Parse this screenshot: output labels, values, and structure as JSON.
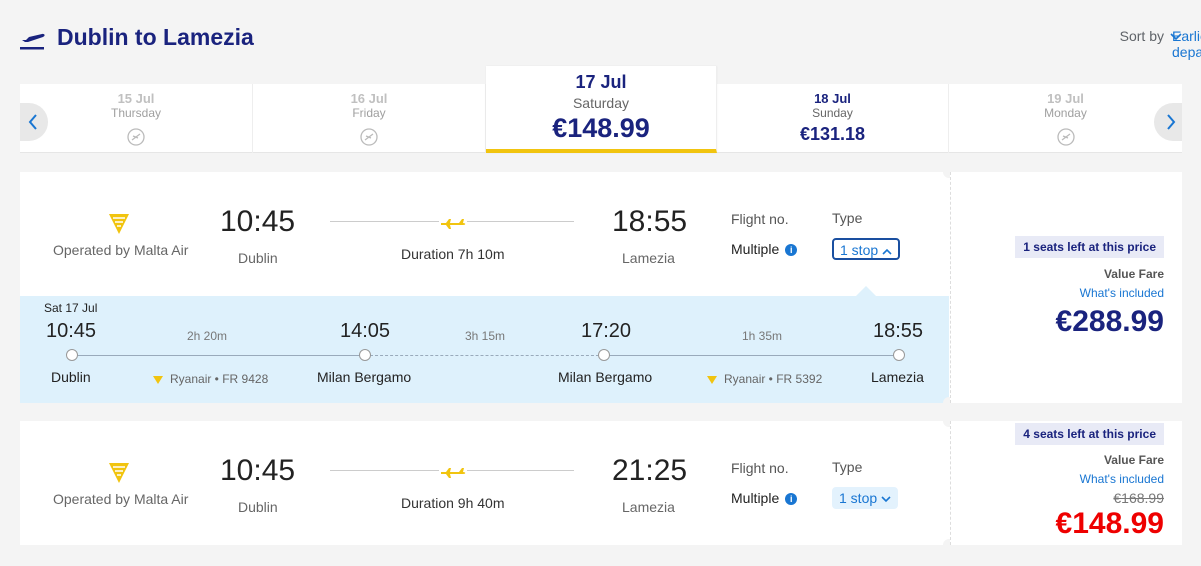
{
  "header": {
    "title": "Dublin to Lamezia",
    "icon": "plane-departure-icon"
  },
  "sort": {
    "label": "Sort by",
    "value": "Earliest departure"
  },
  "dates": [
    {
      "date": "15 Jul",
      "weekday": "Thursday",
      "price": ""
    },
    {
      "date": "16 Jul",
      "weekday": "Friday",
      "price": ""
    },
    {
      "date": "17 Jul",
      "weekday": "Saturday",
      "price": "€148.99"
    },
    {
      "date": "18 Jul",
      "weekday": "Sunday",
      "price": "€131.18"
    },
    {
      "date": "19 Jul",
      "weekday": "Monday",
      "price": ""
    }
  ],
  "flights": [
    {
      "operator": "Operated by Malta Air",
      "depart_time": "10:45",
      "depart_city": "Dublin",
      "duration": "Duration 7h 10m",
      "arrive_time": "18:55",
      "arrive_city": "Lamezia",
      "flight_no_label": "Flight no.",
      "flight_no": "Multiple",
      "type_label": "Type",
      "type": "1 stop",
      "seats": "1 seats left at this price",
      "fare": "Value Fare",
      "included": "What's included",
      "price": "€288.99",
      "details": {
        "day": "Sat 17 Jul",
        "times": [
          "10:45",
          "14:05",
          "17:20",
          "18:55"
        ],
        "segments": [
          "2h 20m",
          "3h 15m",
          "1h 35m"
        ],
        "cities": [
          "Dublin",
          "Milan Bergamo",
          "Milan Bergamo",
          "Lamezia"
        ],
        "operators": [
          "Ryanair • FR 9428",
          "Ryanair • FR 5392"
        ]
      }
    },
    {
      "operator": "Operated by Malta Air",
      "depart_time": "10:45",
      "depart_city": "Dublin",
      "duration": "Duration 9h 40m",
      "arrive_time": "21:25",
      "arrive_city": "Lamezia",
      "flight_no_label": "Flight no.",
      "flight_no": "Multiple",
      "type_label": "Type",
      "type": "1 stop",
      "seats": "4 seats left at this price",
      "fare": "Value Fare",
      "included": "What's included",
      "old_price": "€168.99",
      "price": "€148.99"
    }
  ],
  "colors": {
    "brand": "#1a237e",
    "accent": "#f1c40f",
    "link": "#1976d2",
    "sale": "#ee0000"
  }
}
